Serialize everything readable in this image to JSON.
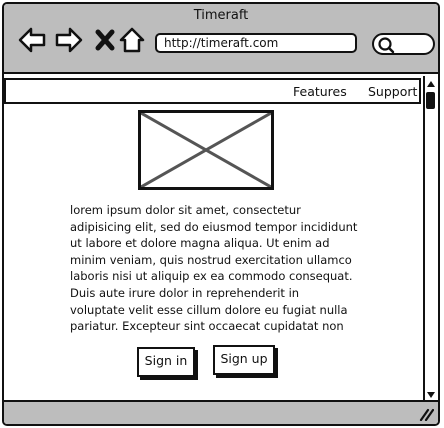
{
  "window": {
    "title": "Timeraft"
  },
  "toolbar": {
    "back_icon": "arrow-left-icon",
    "forward_icon": "arrow-right-icon",
    "stop_icon": "close-x-icon",
    "home_icon": "home-icon",
    "url": "http://timeraft.com",
    "search_icon": "search-icon"
  },
  "menu": {
    "items": [
      "Features",
      "Support"
    ]
  },
  "content": {
    "image": "image-placeholder",
    "paragraph_lines": [
      "lorem ipsum dolor sit amet, consectetur",
      "adipisicing elit, sed do eiusmod tempor incididunt",
      "ut labore et dolore magna aliqua. Ut enim ad",
      "minim veniam, quis nostrud exercitation ullamco",
      "laboris nisi ut aliquip ex ea commodo consequat.",
      "Duis aute irure dolor in reprehenderit in",
      "voluptate velit esse cillum dolore eu fugiat nulla",
      "pariatur. Excepteur sint occaecat cupidatat non"
    ],
    "sign_in_label": "Sign in",
    "sign_up_label": "Sign up"
  },
  "colors": {
    "chrome": "#bdbdbd",
    "ink": "#111111",
    "background": "#ffffff"
  }
}
